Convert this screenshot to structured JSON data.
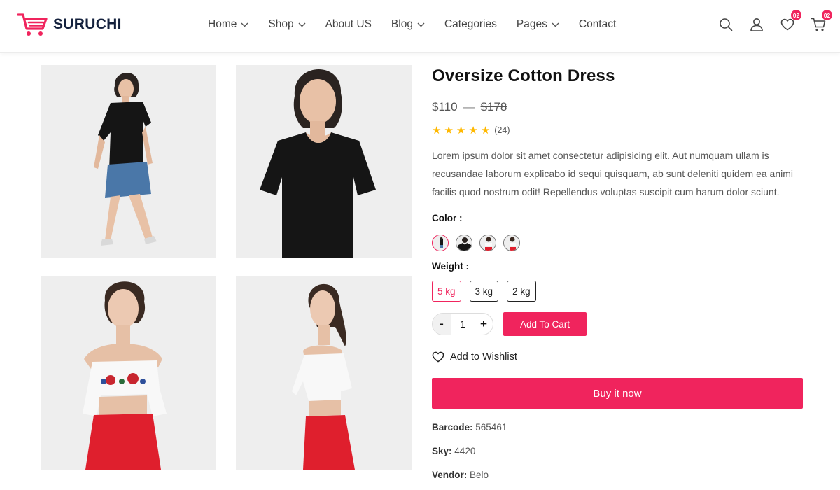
{
  "brand": {
    "name": "SURUCHI",
    "icon": "shopping-cart-logo",
    "accent_color": "#f0245d",
    "text_color": "#14213d"
  },
  "nav": {
    "items": [
      {
        "label": "Home",
        "has_dropdown": true
      },
      {
        "label": "Shop",
        "has_dropdown": true
      },
      {
        "label": "About US",
        "has_dropdown": false
      },
      {
        "label": "Blog",
        "has_dropdown": true
      },
      {
        "label": "Categories",
        "has_dropdown": false
      },
      {
        "label": "Pages",
        "has_dropdown": true
      },
      {
        "label": "Contact",
        "has_dropdown": false
      }
    ]
  },
  "header_icons": {
    "search": "search-icon",
    "account": "user-icon",
    "wishlist_count": "02",
    "cart_count": "02"
  },
  "gallery": {
    "images": [
      {
        "name": "model-black-tee-denim-skirt-full"
      },
      {
        "name": "model-black-tee-closeup"
      },
      {
        "name": "model-white-floral-offshoulder-front"
      },
      {
        "name": "model-white-offshoulder-side"
      }
    ]
  },
  "product": {
    "title": "Oversize Cotton Dress",
    "price_new": "$110",
    "price_separator": "—",
    "price_old": "$178",
    "rating": 5,
    "review_count": "(24)",
    "description": "Lorem ipsum dolor sit amet consectetur adipisicing elit. Aut numquam ullam is recusandae laborum explicabo id sequi quisquam, ab sunt deleniti quidem ea animi facilis quod nostrum odit! Repellendus voluptas suscipit cum harum dolor sciunt.",
    "color_label": "Color :",
    "weight_label": "Weight :",
    "weights": [
      "5 kg",
      "3 kg",
      "2 kg"
    ],
    "quantity": {
      "minus": "-",
      "value": "1",
      "plus": "+"
    },
    "add_to_cart": "Add To Cart",
    "wishlist": "Add to Wishlist",
    "buy_now": "Buy it now",
    "meta": {
      "barcode_label": "Barcode:",
      "barcode": "565461",
      "sky_label": "Sky:",
      "sky": "4420",
      "vendor_label": "Vendor:",
      "vendor": "Belo"
    }
  }
}
